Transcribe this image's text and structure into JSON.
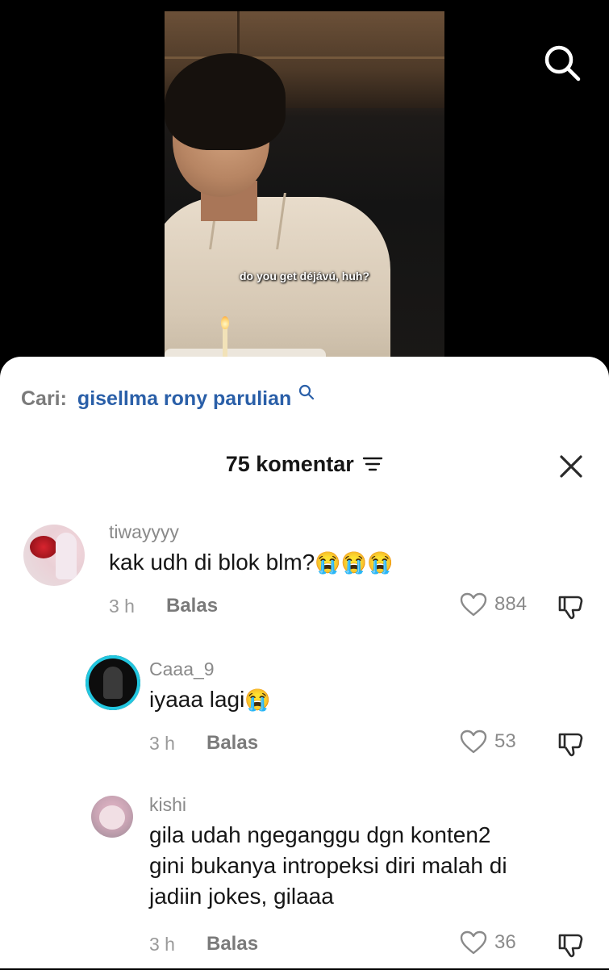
{
  "video": {
    "caption": "do you get déjávú, huh?",
    "search_icon": "search-icon"
  },
  "sheet": {
    "search_prefix": "Cari:",
    "search_query": "gisellma rony parulian",
    "comment_count": "75 komentar",
    "filter_icon": "filter-icon",
    "close_icon": "close-icon"
  },
  "comments": [
    {
      "username": "tiwayyyy",
      "text": "kak udh di blok blm?",
      "emoji": "😭😭😭",
      "time": "3 h",
      "reply_label": "Balas",
      "likes": "884"
    },
    {
      "username": "Caaa_9",
      "text": "iyaaa lagi",
      "emoji": "😭",
      "time": "3 h",
      "reply_label": "Balas",
      "likes": "53"
    },
    {
      "username": "kishi",
      "text_lines": [
        "gila udah ngeganggu dgn konten2",
        "gini bukanya intropeksi diri malah di",
        "jadiin jokes, gilaaa"
      ],
      "time": "3 h",
      "reply_label": "Balas",
      "likes": "36"
    }
  ],
  "colors": {
    "link_blue": "#2a5fa8",
    "avatar_ring": "#22c7e0"
  }
}
